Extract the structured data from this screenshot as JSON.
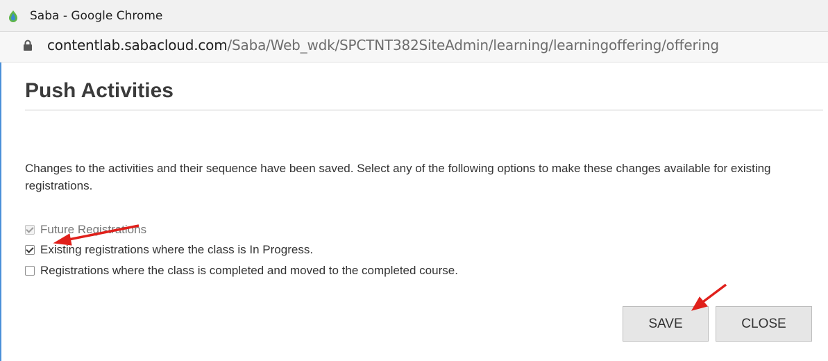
{
  "browser": {
    "window_title": "Saba - Google Chrome",
    "url_host": "contentlab.sabacloud.com",
    "url_path": "/Saba/Web_wdk/SPCTNT382SiteAdmin/learning/learningoffering/offering"
  },
  "dialog": {
    "title": "Push Activities",
    "message": "Changes to the activities and their sequence have been saved. Select any of the following options to make these changes available for existing registrations.",
    "options": [
      {
        "label": "Future Registrations",
        "checked": true,
        "disabled": true
      },
      {
        "label": "Existing registrations where the class is In Progress.",
        "checked": true,
        "disabled": false
      },
      {
        "label": "Registrations where the class is completed and moved to the completed course.",
        "checked": false,
        "disabled": false
      }
    ],
    "buttons": {
      "save": "SAVE",
      "close": "CLOSE"
    }
  },
  "colors": {
    "annotation_arrow": "#e0201b",
    "frame_accent": "#4a90d9"
  }
}
